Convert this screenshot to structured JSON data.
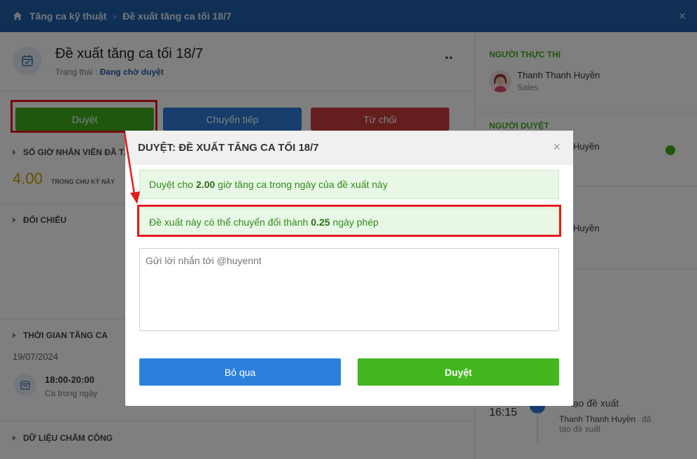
{
  "breadcrumb": {
    "home_icon": "home-icon",
    "item1": "Tăng ca kỹ thuật",
    "separator": "›",
    "item2": "Đề xuất tăng ca tối 18/7",
    "close": "×"
  },
  "header": {
    "title": "Đề xuất tăng ca tối 18/7",
    "status_label": "Trạng thái :",
    "status_value": "Đang chờ duyệt",
    "menu_icon": "••"
  },
  "actions": {
    "approve": "Duyệt",
    "forward": "Chuyển tiếp",
    "reject": "Từ chối"
  },
  "sections": {
    "hours": "SỐ GIỜ NHÂN VIÊN ĐÃ TĂ",
    "hours_value": "4.00",
    "hours_caption": "TRONG CHU KỲ NÀY",
    "compare": "ĐỐI CHIẾU",
    "ot_time": "THỜI GIAN TĂNG CA",
    "ot_date": "19/07/2024",
    "ot_range": "18:00-20:00",
    "ot_note": "Ca trong ngày",
    "attendance": "DỮ LIỆU CHẤM CÔNG"
  },
  "side": {
    "executor_title": "NGƯỜI THỰC THI",
    "executor_name": "Thanh Thanh Huyền",
    "executor_role": "Sales",
    "approver_title": "NGƯỜI DUYỆT",
    "approver_name_1": "Huyền",
    "approver_name_2": "Huyền",
    "timeline_time": "16:15",
    "timeline_action": "tạo đề xuất",
    "timeline_actor": "Thanh Thanh Huyền",
    "timeline_actor_suffix": "đã",
    "timeline_detail": "tạo đề xuất",
    "status_color": "#3fae1f"
  },
  "modal": {
    "title": "DUYỆT: ĐỀ XUẤT TĂNG CA TỐI 18/7",
    "close": "×",
    "alert1_prefix": "Duyệt cho",
    "alert1_value": "2.00",
    "alert1_suffix": "giờ tăng ca trong ngày của đề xuất này",
    "alert2_prefix": "Đề xuất này có thể chuyển đổi thành",
    "alert2_value": "0.25",
    "alert2_suffix": "ngày phép",
    "message_placeholder": "Gửi lời nhắn tới @huyennt",
    "skip_button": "Bỏ qua",
    "approve_button": "Duyệt"
  },
  "colors": {
    "brand": "#1f5ea8",
    "approve": "#3fae1f",
    "forward": "#2c7ad6",
    "reject": "#c93d3d",
    "highlight": "#e31b1b"
  }
}
